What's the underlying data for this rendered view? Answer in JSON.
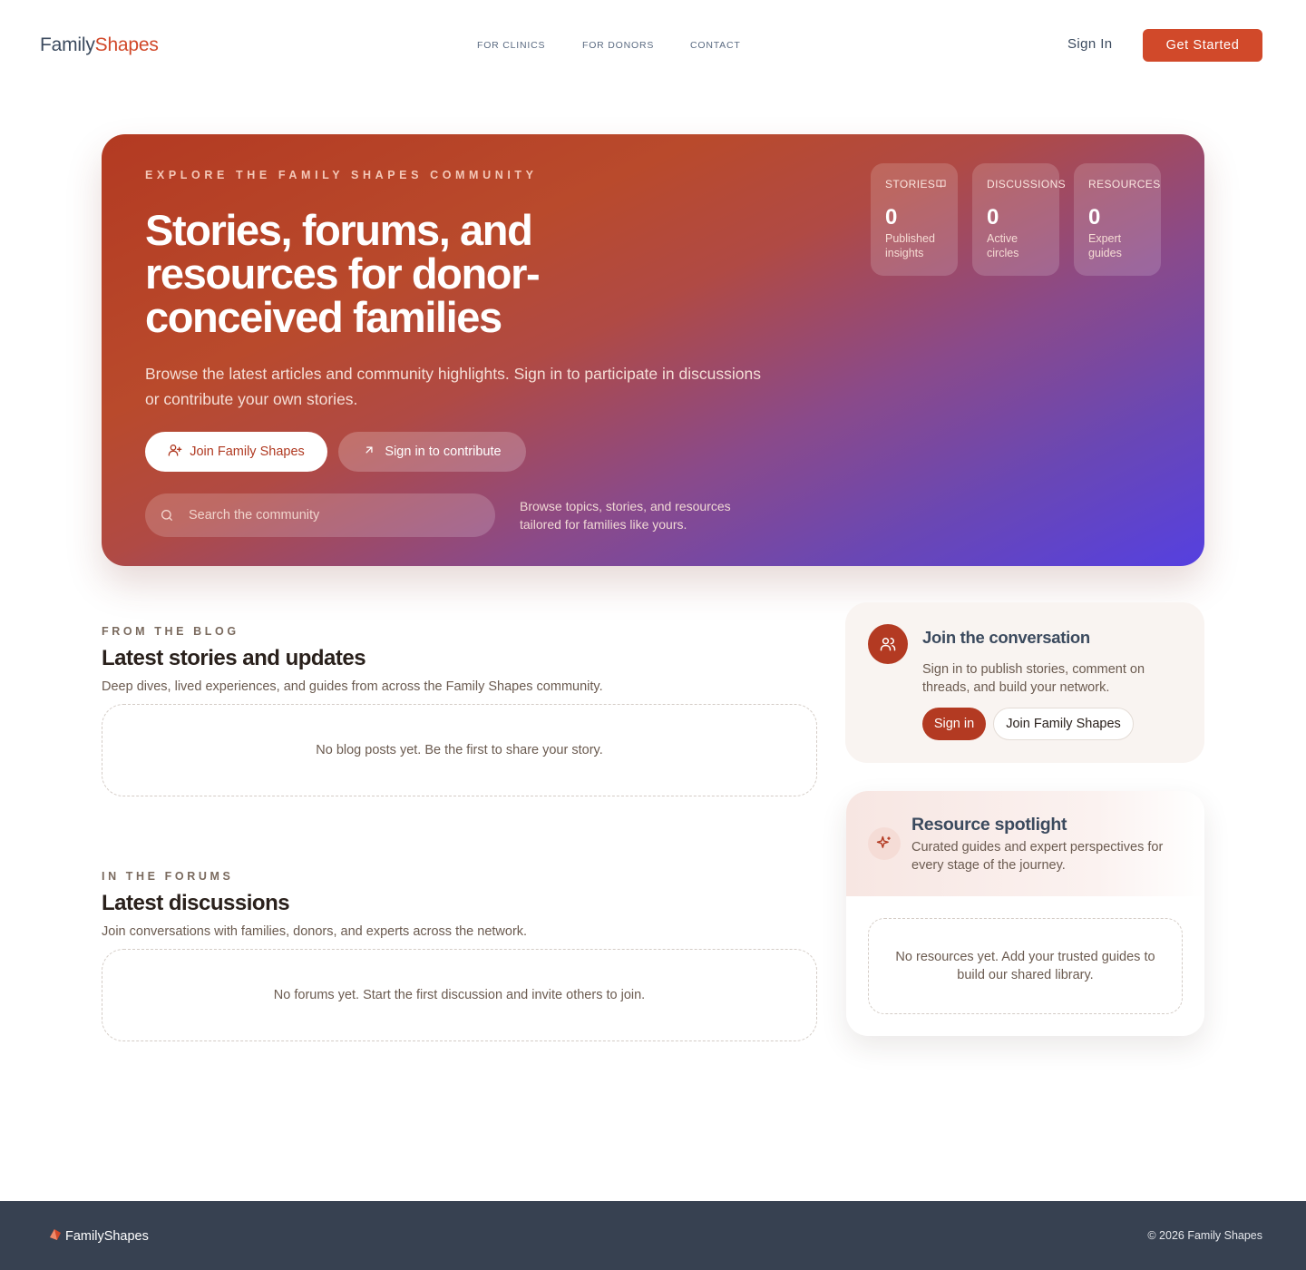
{
  "header": {
    "logo_part1": "Family",
    "logo_part2": "Shapes",
    "nav": [
      "FOR CLINICS",
      "FOR DONORS",
      "CONTACT"
    ],
    "sign_in": "Sign In",
    "get_started": "Get Started"
  },
  "hero": {
    "eyebrow": "EXPLORE THE FAMILY SHAPES COMMUNITY",
    "title": "Stories, forums, and resources for donor-conceived families",
    "description": "Browse the latest articles and community highlights. Sign in to participate in discussions or contribute your own stories.",
    "join_button": "Join Family Shapes",
    "contribute_button": "Sign in to contribute",
    "search_placeholder": "Search the community",
    "search_note": "Browse topics, stories, and resources tailored for families like yours.",
    "stats": [
      {
        "label": "STORIES",
        "value": "0",
        "sub": "Published insights",
        "icon": "book-icon"
      },
      {
        "label": "DISCUSSIONS",
        "value": "0",
        "sub": "Active circles"
      },
      {
        "label": "RESOURCES",
        "value": "0",
        "sub": "Expert guides"
      }
    ]
  },
  "blog": {
    "eyebrow": "FROM THE BLOG",
    "title": "Latest stories and updates",
    "description": "Deep dives, lived experiences, and guides from across the Family Shapes community.",
    "empty": "No blog posts yet. Be the first to share your story."
  },
  "forums": {
    "eyebrow": "IN THE FORUMS",
    "title": "Latest discussions",
    "description": "Join conversations with families, donors, and experts across the network.",
    "empty": "No forums yet. Start the first discussion and invite others to join."
  },
  "join_card": {
    "title": "Join the conversation",
    "description": "Sign in to publish stories, comment on threads, and build your network.",
    "sign_in": "Sign in",
    "join": "Join Family Shapes"
  },
  "resource_card": {
    "title": "Resource spotlight",
    "description": "Curated guides and expert perspectives for every stage of the journey.",
    "empty": "No resources yet. Add your trusted guides to build our shared library."
  },
  "footer": {
    "logo": "FamilyShapes",
    "copyright": "© 2026 Family Shapes"
  },
  "colors": {
    "brand": "#d1492a",
    "brand_dark": "#b33a22",
    "hero_gradient_end": "#5540e0",
    "footer_bg": "#374151"
  }
}
